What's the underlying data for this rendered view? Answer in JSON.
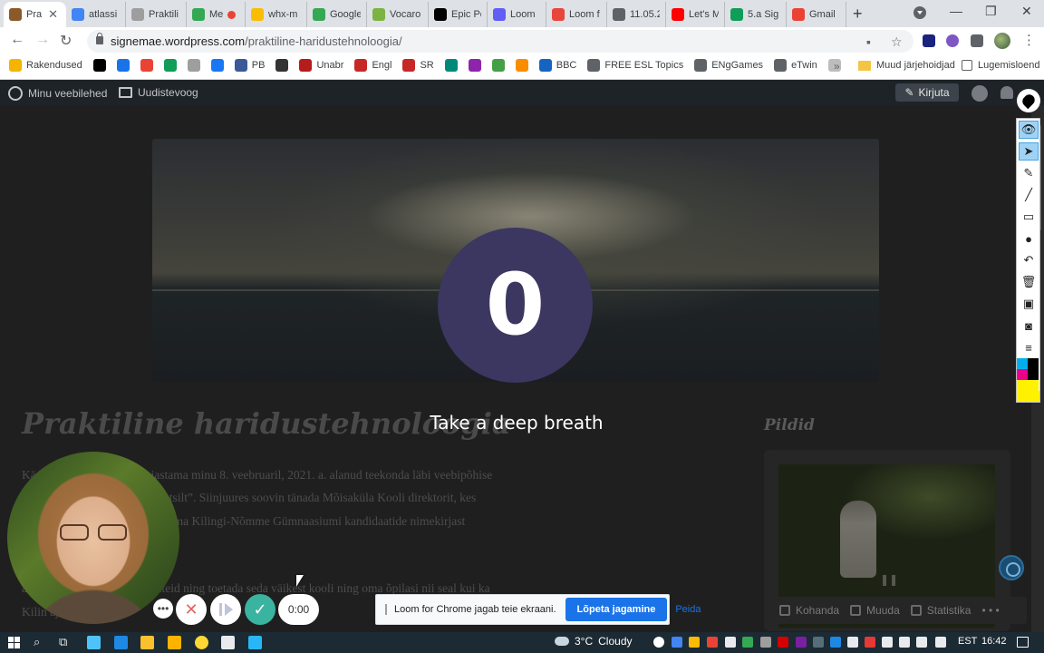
{
  "browser": {
    "tabs": [
      {
        "label": "Pra",
        "favicon_color": "#8b5a2b",
        "active": true
      },
      {
        "label": "atlassi",
        "favicon_color": "#4285f4"
      },
      {
        "label": "Praktili",
        "favicon_color": "#9e9e9e"
      },
      {
        "label": "Me",
        "favicon_color": "#34a853",
        "recording_dot": "#ea4335"
      },
      {
        "label": "whx-m",
        "favicon_color": "#fbbc04"
      },
      {
        "label": "Google",
        "favicon_color": "#34a853"
      },
      {
        "label": "Vocaro",
        "favicon_color": "#7cb342"
      },
      {
        "label": "Epic Pe",
        "favicon_color": "#000000"
      },
      {
        "label": "Loom",
        "favicon_color": "#625df5"
      },
      {
        "label": "Loom f",
        "favicon_color": "#e8453c"
      },
      {
        "label": "11.05.2",
        "favicon_color": "#5f6368"
      },
      {
        "label": "Let's M",
        "favicon_color": "#ff0000"
      },
      {
        "label": "5.a Sig",
        "favicon_color": "#0f9d58"
      },
      {
        "label": "Gmail",
        "favicon_color": "#ea4335"
      }
    ],
    "new_tab_label": "+",
    "window_controls": {
      "minimize": "—",
      "restore": "❐",
      "close": "✕"
    },
    "url_host": "signemae.wordpress.com",
    "url_path": "/praktiline-haridustehnoloogia/",
    "bookmarks": [
      {
        "label": "Rakendused",
        "color": "#f4b400"
      },
      {
        "label": "",
        "color": "#000000"
      },
      {
        "label": "",
        "color": "#1a73e8"
      },
      {
        "label": "",
        "color": "#ea4335"
      },
      {
        "label": "",
        "color": "#0f9d58"
      },
      {
        "label": "",
        "color": "#9e9e9e"
      },
      {
        "label": "",
        "color": "#1877f2"
      },
      {
        "label": "PB",
        "color": "#3b5998"
      },
      {
        "label": "",
        "color": "#333333"
      },
      {
        "label": "Unabr",
        "color": "#b71c1c"
      },
      {
        "label": "Engl",
        "color": "#c62828"
      },
      {
        "label": "SR",
        "color": "#c62828"
      },
      {
        "label": "",
        "color": "#00897b"
      },
      {
        "label": "",
        "color": "#8e24aa"
      },
      {
        "label": "",
        "color": "#43a047"
      },
      {
        "label": "",
        "color": "#fb8c00"
      },
      {
        "label": "BBC",
        "color": "#1565c0"
      },
      {
        "label": "FREE ESL Topics",
        "color": "#5f6368"
      },
      {
        "label": "ENgGames",
        "color": "#5f6368"
      },
      {
        "label": "eTwin",
        "color": "#5f6368"
      },
      {
        "label": "",
        "color": "#bdbdbd"
      }
    ],
    "bookmarks_more": "»",
    "other_bookmarks": "Muud järjehoidjad",
    "reading_list": "Lugemisloend"
  },
  "wp_admin": {
    "my_sites": "Minu veebilehed",
    "reader": "Uudistevoog",
    "write": "Kirjuta"
  },
  "post": {
    "title": "Praktiline haridustehnoloogia",
    "paragraph1_line1": "Kä                         b, moodulite kaupa, kajastama minu 8. veebruaril, 2021. a. alanud teekonda läbi veebipõhise",
    "paragraph1_line2": "                               line haridustehnoloogia distantsilt”. Siinjuures soovin tänada Mõisaküla Kooli direktorit, kes",
    "paragraph1_line3": "                               inu programmis osalemist, kui ma Kilingi-Nõmme Gümnaasiumi kandidaatide nimekirjast",
    "paragraph2_line1": "                        an edaspidigi jagada hal  mõtteid ning toetada seda väikest kooli ning oma õpilasi nii seal kui ka",
    "paragraph2_line2": "Kilin                                          aja tööala"
  },
  "sidebar": {
    "heading": "Pildid",
    "video_pause_glyph": "❚❚"
  },
  "customizer": {
    "customize": "Kohanda",
    "edit": "Muuda",
    "stats": "Statistika",
    "more": "• • •"
  },
  "loom": {
    "countdown": "0",
    "caption": "Take a deep breath",
    "timer": "0:00",
    "more_glyph": "•••",
    "cancel_glyph": "✕",
    "done_glyph": "✓"
  },
  "share_notice": {
    "text": "Loom for Chrome jagab teie ekraani.",
    "stop_button": "Lõpeta jagamine",
    "hide_link": "Peida"
  },
  "epic_pen": {
    "tools": [
      {
        "name": "eye-icon",
        "glyph": "👁",
        "selected": true
      },
      {
        "name": "cursor-icon",
        "glyph": "➤",
        "selected": true
      },
      {
        "name": "pen-icon",
        "glyph": "✎"
      },
      {
        "name": "line-icon",
        "glyph": "╱"
      },
      {
        "name": "eraser-icon",
        "glyph": "▭"
      },
      {
        "name": "dot-icon",
        "glyph": "●"
      },
      {
        "name": "undo-icon",
        "glyph": "↶"
      },
      {
        "name": "trash-icon",
        "glyph": "🗑"
      },
      {
        "name": "board-icon",
        "glyph": "▣"
      },
      {
        "name": "camera-icon",
        "glyph": "◙"
      },
      {
        "name": "notes-icon",
        "glyph": "≡"
      }
    ],
    "swatch_colors": [
      "#00aeef",
      "#000000",
      "#ec008c",
      "#000000",
      "#fff200",
      "#fff200"
    ]
  },
  "taskbar": {
    "weather_temp": "3°C",
    "weather_text": "Cloudy",
    "language": "EST",
    "time": "16:42",
    "pinned_colors": [
      "#4fc3f7",
      "#1e88e5",
      "#fbc02d",
      "#ffb300",
      "#fdd835",
      "#e8eaed",
      "#29b6f6"
    ]
  }
}
